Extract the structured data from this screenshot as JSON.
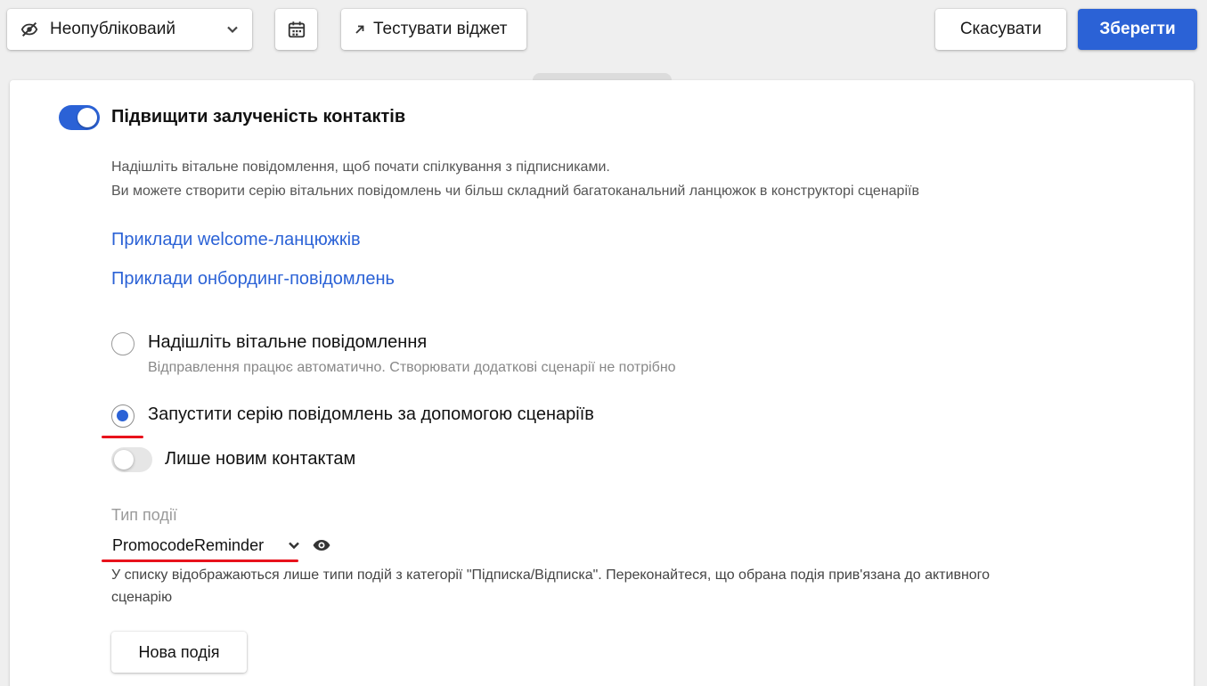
{
  "toolbar": {
    "status_select": {
      "value": "Неопубліковаий",
      "icon": "eye-off-icon"
    },
    "calendar_icon": "calendar-icon",
    "test_widget_label": "Тестувати віджет",
    "cancel_label": "Скасувати",
    "save_label": "Зберегти"
  },
  "card": {
    "toggle_on": true,
    "title": "Підвищити залученість контактів",
    "description_line1": "Надішліть вітальне повідомлення, щоб почати спілкування з підписниками.",
    "description_line2": "Ви можете створити серію вітальних повідомлень чи більш складний багатоканальний ланцюжок в конструкторі сценаріїв",
    "link1": "Приклади welcome-ланцюжків",
    "link2": "Приклади онбординг-повідомлень",
    "option1": {
      "label": "Надішліть вітальне повідомлення",
      "hint": "Відправлення працює автоматично. Створювати додаткові сценарії не потрібно",
      "selected": false
    },
    "option2": {
      "label": "Запустити серію повідомлень за допомогою сценаріїв",
      "selected": true
    },
    "new_contacts_toggle": {
      "label": "Лише новим контактам",
      "on": false
    },
    "event_type": {
      "label": "Тип події",
      "value": "PromocodeReminder",
      "note_line1": "У списку відображаються лише типи подій з категорії \"Підписка/Відписка\". Переконайтеся, що обрана подія прив'язана до активного",
      "note_line2": "сценарію"
    },
    "new_event_label": "Нова подія"
  },
  "colors": {
    "accent": "#2b62d6",
    "annotation_red": "#e8121c",
    "background": "#efefef"
  }
}
